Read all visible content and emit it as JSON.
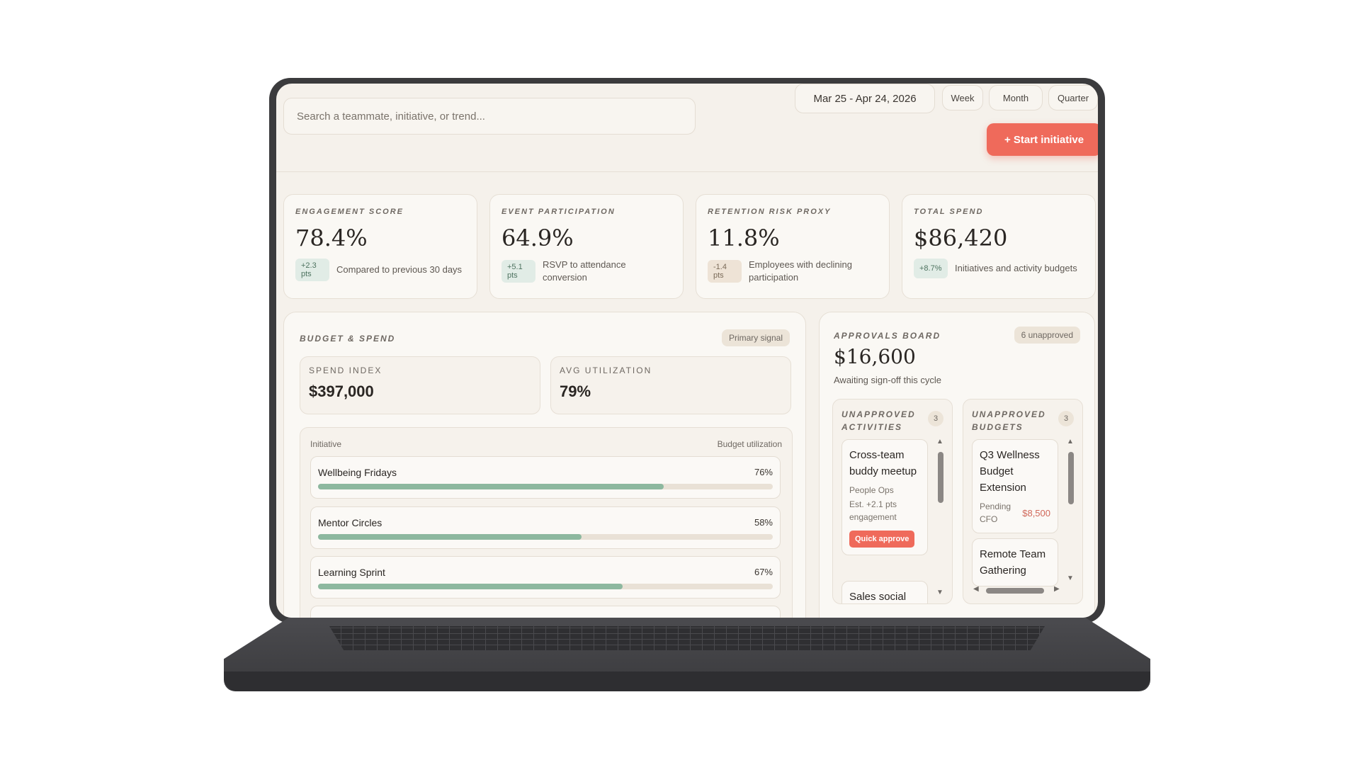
{
  "search": {
    "placeholder": "Search a teammate, initiative, or trend..."
  },
  "date_range": "Mar 25 - Apr 24, 2026",
  "period_options": [
    "Week",
    "Month",
    "Quarter"
  ],
  "start_button": "+ Start initiative",
  "kpis": [
    {
      "label": "ENGAGEMENT SCORE",
      "value": "78.4%",
      "delta_top": "+2.3",
      "delta_bottom": "pts",
      "desc": "Compared to previous 30 days"
    },
    {
      "label": "EVENT PARTICIPATION",
      "value": "64.9%",
      "delta_top": "+5.1",
      "delta_bottom": "pts",
      "desc": "RSVP to attendance conversion"
    },
    {
      "label": "RETENTION RISK PROXY",
      "value": "11.8%",
      "delta_top": "-1.4",
      "delta_bottom": "pts",
      "desc": "Employees with declining participation"
    },
    {
      "label": "TOTAL SPEND",
      "value": "$86,420",
      "delta_top": "+8.7%",
      "delta_bottom": "",
      "desc": "Initiatives and activity budgets"
    }
  ],
  "budget": {
    "title": "BUDGET & SPEND",
    "badge": "Primary signal",
    "spend_index_label": "SPEND INDEX",
    "spend_index_value": "$397,000",
    "avg_util_label": "AVG UTILIZATION",
    "avg_util_value": "79%",
    "col_initiative": "Initiative",
    "col_util": "Budget utilization",
    "rows": [
      {
        "name": "Wellbeing Fridays",
        "pct_label": "76%",
        "utilization": 0.76
      },
      {
        "name": "Mentor Circles",
        "pct_label": "58%",
        "utilization": 0.58
      },
      {
        "name": "Learning Sprint",
        "pct_label": "67%",
        "utilization": 0.67
      }
    ]
  },
  "approvals": {
    "title": "APPROVALS BOARD",
    "badge": "6 unapproved",
    "amount": "$16,600",
    "subtitle": "Awaiting sign-off this cycle",
    "activities": {
      "title_line1": "UNAPPROVED",
      "title_line2": "ACTIVITIES",
      "count": "3",
      "card1": {
        "title": "Cross-team buddy meetup",
        "team": "People Ops",
        "impact": "Est. +2.1 pts engagement",
        "action": "Quick approve"
      },
      "card2_title": "Sales social"
    },
    "budgets": {
      "title_line1": "UNAPPROVED",
      "title_line2": "BUDGETS",
      "count": "3",
      "card1": {
        "title": "Q3 Wellness Budget Extension",
        "status": "Pending CFO",
        "amount": "$8,500"
      },
      "card2_title": "Remote Team Gathering"
    }
  },
  "colors": {
    "accent": "#ef6a5b",
    "bar": "#8db89f",
    "background": "#f5f1eb"
  }
}
